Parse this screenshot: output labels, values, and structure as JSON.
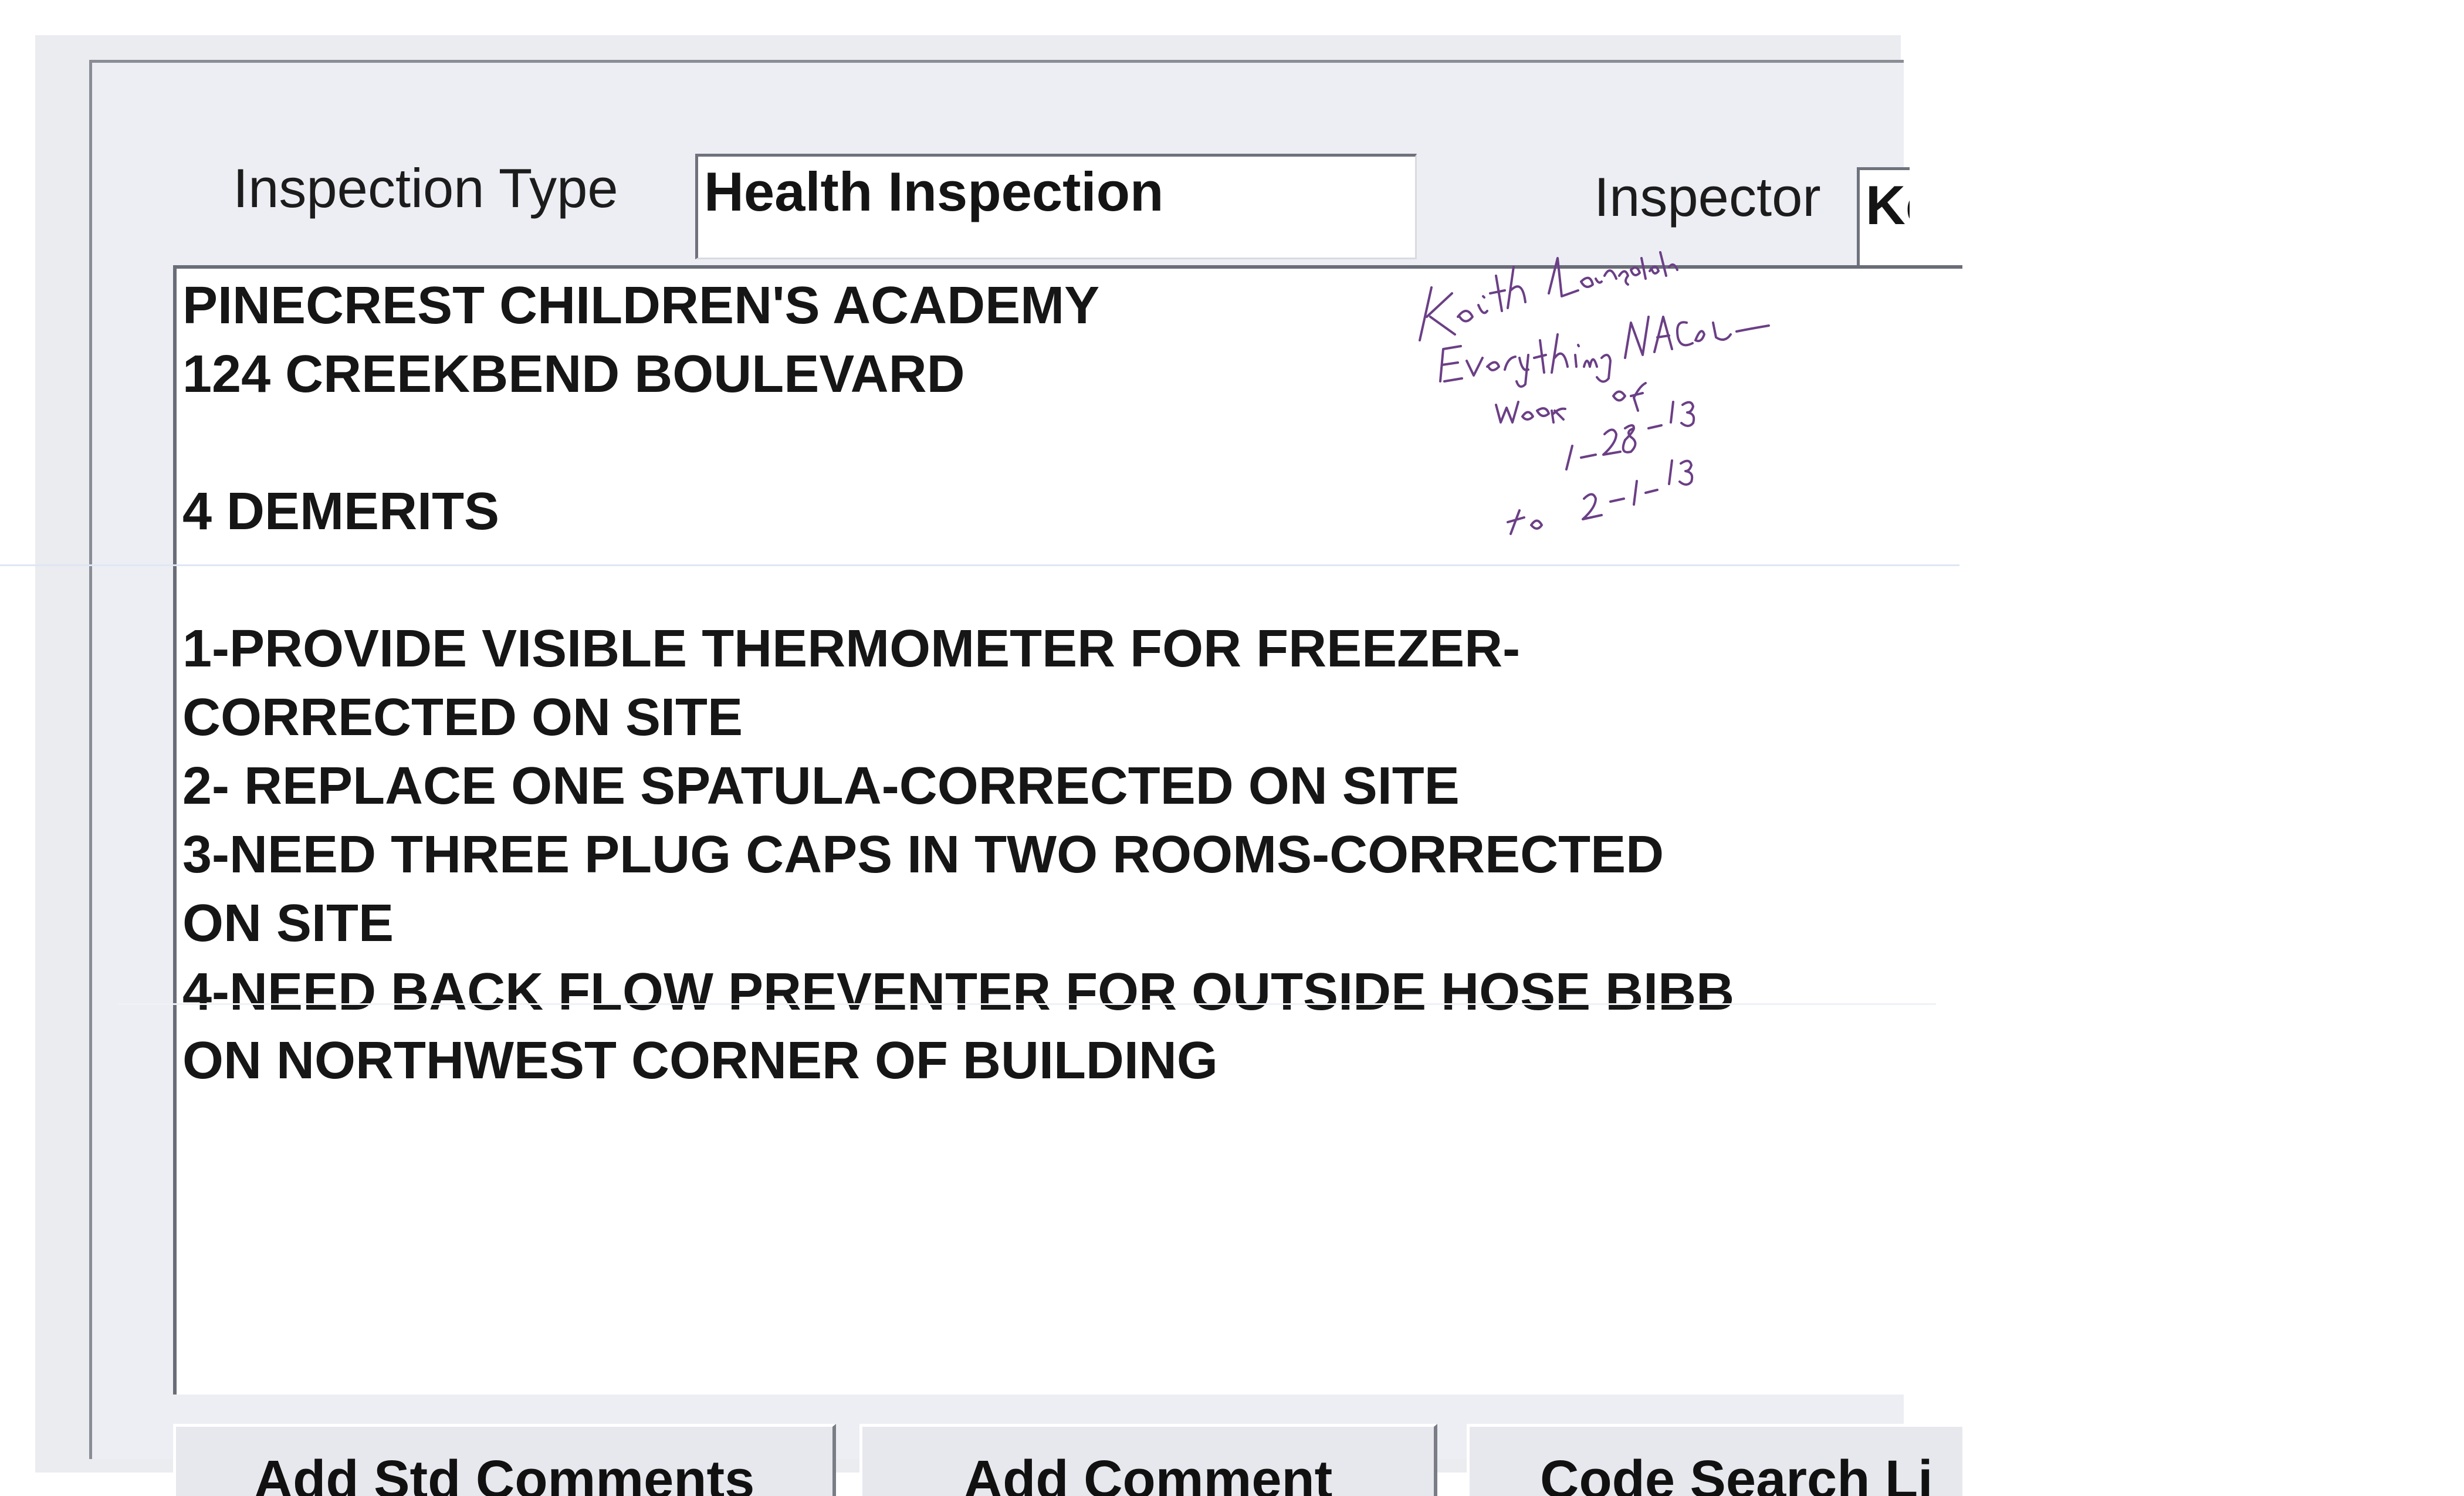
{
  "form": {
    "inspection_type_label": "Inspection Type",
    "inspection_type_value": "Health Inspection",
    "inspector_label": "Inspector",
    "inspector_value": "Ke"
  },
  "comments": {
    "lines": [
      "PINECREST CHILDREN'S ACADEMY",
      "124 CREEKBEND BOULEVARD",
      "",
      "4 DEMERITS",
      "",
      "1-PROVIDE VISIBLE THERMOMETER FOR FREEZER-",
      "CORRECTED ON SITE",
      "2- REPLACE ONE SPATULA-CORRECTED ON SITE",
      "3-NEED THREE PLUG CAPS IN TWO ROOMS-CORRECTED",
      "ON SITE",
      "4-NEED BACK FLOW PREVENTER FOR OUTSIDE HOSE BIBB",
      "ON NORTHWEST CORNER OF BUILDING"
    ]
  },
  "handwritten_note": {
    "lines": [
      "Keith Lansdale",
      "Everything NAC(clean)",
      "week of",
      "1-28-13",
      "to 2-1-13"
    ],
    "ink_color": "#6b3f86"
  },
  "buttons": {
    "add_std_comments": {
      "pre": "Add ",
      "mnemonic": "S",
      "post": "td Comments"
    },
    "add_comment": {
      "pre": "",
      "mnemonic": "A",
      "post": "dd Comment"
    },
    "code_search": {
      "pre": "Code Search Li",
      "mnemonic": "",
      "post": ""
    }
  }
}
